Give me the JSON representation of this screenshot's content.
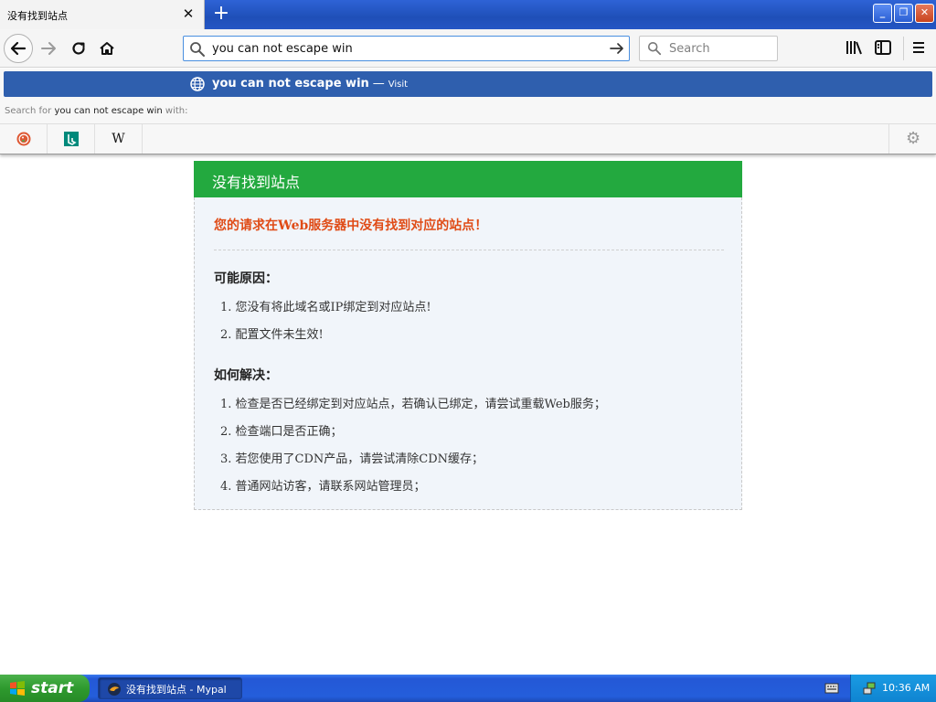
{
  "browser": {
    "tab_title": "没有找到站点",
    "url_value": "you can not escape win",
    "search_placeholder": "Search"
  },
  "autocomplete": {
    "query": "you can not escape win",
    "separator": "—",
    "action": "Visit",
    "search_for_prefix": "Search for",
    "search_for_suffix": "with:",
    "engines": [
      {
        "name": "DuckDuckGo",
        "icon": "duckduckgo-icon"
      },
      {
        "name": "Bing",
        "icon": "bing-icon"
      },
      {
        "name": "Wikipedia",
        "icon": "wikipedia-icon",
        "glyph": "W"
      }
    ]
  },
  "page": {
    "title": "没有找到站点",
    "error": "您的请求在Web服务器中没有找到对应的站点！",
    "reasons_title": "可能原因：",
    "reasons": [
      "1. 您没有将此域名或IP绑定到对应站点!",
      "2. 配置文件未生效!"
    ],
    "solutions_title": "如何解决：",
    "solutions": [
      "1. 检查是否已经绑定到对应站点，若确认已绑定，请尝试重载Web服务；",
      "2. 检查端口是否正确；",
      "3. 若您使用了CDN产品，请尝试清除CDN缓存；",
      "4. 普通网站访客，请联系网站管理员；"
    ]
  },
  "taskbar": {
    "start_label": "start",
    "task_label": "没有找到站点 - Mypal",
    "clock": "10:36 AM"
  },
  "colors": {
    "header_green": "#23a93f",
    "error_orange": "#e04b16",
    "autocomplete_blue": "#2f5fae"
  }
}
